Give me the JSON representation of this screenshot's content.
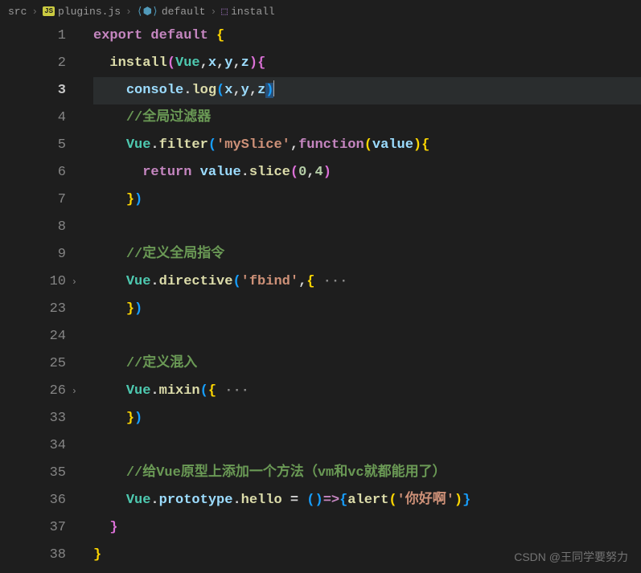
{
  "breadcrumb": {
    "items": [
      {
        "label": "src",
        "icon": null
      },
      {
        "label": "plugins.js",
        "icon": "js"
      },
      {
        "label": "default",
        "icon": "module"
      },
      {
        "label": "install",
        "icon": "cube"
      }
    ]
  },
  "editor": {
    "currentLine": 3,
    "lines": [
      {
        "num": "1",
        "fold": false,
        "tokens": [
          [
            "keyword",
            "export"
          ],
          [
            "punc",
            " "
          ],
          [
            "keyword",
            "default"
          ],
          [
            "punc",
            " "
          ],
          [
            "brace-y",
            "{"
          ]
        ]
      },
      {
        "num": "2",
        "fold": false,
        "tokens": [
          [
            "punc",
            "  "
          ],
          [
            "func",
            "install"
          ],
          [
            "brace-p",
            "("
          ],
          [
            "obj",
            "Vue"
          ],
          [
            "punc",
            ","
          ],
          [
            "var",
            "x"
          ],
          [
            "punc",
            ","
          ],
          [
            "var",
            "y"
          ],
          [
            "punc",
            ","
          ],
          [
            "var",
            "z"
          ],
          [
            "brace-p",
            ")"
          ],
          [
            "brace-p",
            "{"
          ]
        ]
      },
      {
        "num": "3",
        "fold": false,
        "tokens": [
          [
            "punc",
            "    "
          ],
          [
            "var",
            "console"
          ],
          [
            "punc",
            "."
          ],
          [
            "func",
            "log"
          ],
          [
            "brace-b",
            "("
          ],
          [
            "var",
            "x"
          ],
          [
            "punc",
            ","
          ],
          [
            "var",
            "y"
          ],
          [
            "punc",
            ","
          ],
          [
            "var",
            "z"
          ],
          [
            "sel",
            ")"
          ],
          [
            "cursor",
            ""
          ]
        ]
      },
      {
        "num": "4",
        "fold": false,
        "tokens": [
          [
            "punc",
            "    "
          ],
          [
            "comment",
            "//全局过滤器"
          ]
        ]
      },
      {
        "num": "5",
        "fold": false,
        "tokens": [
          [
            "punc",
            "    "
          ],
          [
            "obj",
            "Vue"
          ],
          [
            "punc",
            "."
          ],
          [
            "func",
            "filter"
          ],
          [
            "brace-b",
            "("
          ],
          [
            "str",
            "'mySlice'"
          ],
          [
            "punc",
            ","
          ],
          [
            "keyword",
            "function"
          ],
          [
            "brace-y",
            "("
          ],
          [
            "var",
            "value"
          ],
          [
            "brace-y",
            ")"
          ],
          [
            "brace-y",
            "{"
          ]
        ]
      },
      {
        "num": "6",
        "fold": false,
        "tokens": [
          [
            "punc",
            "      "
          ],
          [
            "keyword",
            "return"
          ],
          [
            "punc",
            " "
          ],
          [
            "var",
            "value"
          ],
          [
            "punc",
            "."
          ],
          [
            "func",
            "slice"
          ],
          [
            "brace-p",
            "("
          ],
          [
            "num",
            "0"
          ],
          [
            "punc",
            ","
          ],
          [
            "num",
            "4"
          ],
          [
            "brace-p",
            ")"
          ]
        ]
      },
      {
        "num": "7",
        "fold": false,
        "tokens": [
          [
            "punc",
            "    "
          ],
          [
            "brace-y",
            "}"
          ],
          [
            "brace-b",
            ")"
          ]
        ]
      },
      {
        "num": "8",
        "fold": false,
        "tokens": []
      },
      {
        "num": "9",
        "fold": false,
        "tokens": [
          [
            "punc",
            "    "
          ],
          [
            "comment",
            "//定义全局指令"
          ]
        ]
      },
      {
        "num": "10",
        "fold": true,
        "tokens": [
          [
            "punc",
            "    "
          ],
          [
            "obj",
            "Vue"
          ],
          [
            "punc",
            "."
          ],
          [
            "func",
            "directive"
          ],
          [
            "brace-b",
            "("
          ],
          [
            "str",
            "'fbind'"
          ],
          [
            "punc",
            ","
          ],
          [
            "brace-y",
            "{"
          ],
          [
            "dots",
            " ···"
          ]
        ]
      },
      {
        "num": "23",
        "fold": false,
        "tokens": [
          [
            "punc",
            "    "
          ],
          [
            "brace-y",
            "}"
          ],
          [
            "brace-b",
            ")"
          ]
        ]
      },
      {
        "num": "24",
        "fold": false,
        "tokens": []
      },
      {
        "num": "25",
        "fold": false,
        "tokens": [
          [
            "punc",
            "    "
          ],
          [
            "comment",
            "//定义混入"
          ]
        ]
      },
      {
        "num": "26",
        "fold": true,
        "tokens": [
          [
            "punc",
            "    "
          ],
          [
            "obj",
            "Vue"
          ],
          [
            "punc",
            "."
          ],
          [
            "func",
            "mixin"
          ],
          [
            "brace-b",
            "("
          ],
          [
            "brace-y",
            "{"
          ],
          [
            "dots",
            " ···"
          ]
        ]
      },
      {
        "num": "33",
        "fold": false,
        "tokens": [
          [
            "punc",
            "    "
          ],
          [
            "brace-y",
            "}"
          ],
          [
            "brace-b",
            ")"
          ]
        ]
      },
      {
        "num": "34",
        "fold": false,
        "tokens": []
      },
      {
        "num": "35",
        "fold": false,
        "tokens": [
          [
            "punc",
            "    "
          ],
          [
            "comment",
            "//给Vue原型上添加一个方法（vm和vc就都能用了）"
          ]
        ]
      },
      {
        "num": "36",
        "fold": false,
        "tokens": [
          [
            "punc",
            "    "
          ],
          [
            "obj",
            "Vue"
          ],
          [
            "punc",
            "."
          ],
          [
            "var",
            "prototype"
          ],
          [
            "punc",
            "."
          ],
          [
            "func",
            "hello"
          ],
          [
            "punc",
            " "
          ],
          [
            "punc",
            "="
          ],
          [
            "punc",
            " "
          ],
          [
            "brace-b",
            "("
          ],
          [
            "brace-b",
            ")"
          ],
          [
            "keyword",
            "=>"
          ],
          [
            "brace-b",
            "{"
          ],
          [
            "func",
            "alert"
          ],
          [
            "brace-y",
            "("
          ],
          [
            "str",
            "'你好啊'"
          ],
          [
            "brace-y",
            ")"
          ],
          [
            "brace-b",
            "}"
          ]
        ]
      },
      {
        "num": "37",
        "fold": false,
        "tokens": [
          [
            "punc",
            "  "
          ],
          [
            "brace-p",
            "}"
          ]
        ]
      },
      {
        "num": "38",
        "fold": false,
        "tokens": [
          [
            "brace-y",
            "}"
          ]
        ]
      }
    ]
  },
  "watermark": "CSDN @王同学要努力"
}
